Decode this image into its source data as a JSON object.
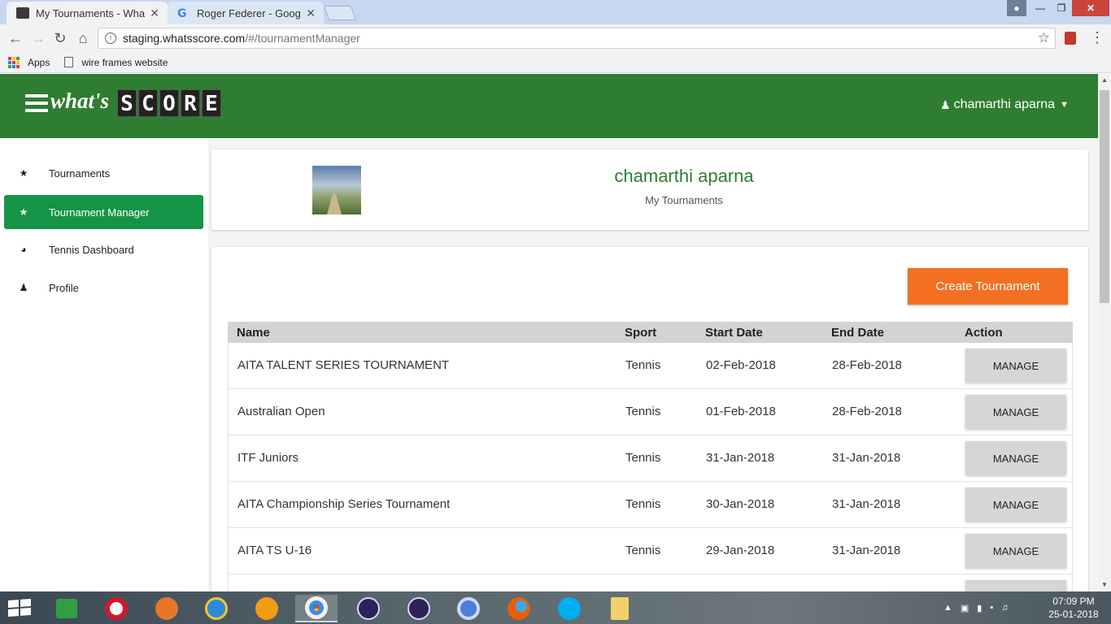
{
  "browser": {
    "tabs": [
      {
        "title": "My Tournaments - What",
        "close": "✕"
      },
      {
        "title": "Roger Federer - Google S",
        "close": "✕"
      }
    ],
    "url_host": "staging.whatsscore.com",
    "url_path": "/#/tournamentManager",
    "bookmarks": [
      {
        "label": "Apps"
      },
      {
        "label": "wire frames website"
      }
    ]
  },
  "header": {
    "logo_prefix": "what's",
    "logo_letters": [
      "S",
      "C",
      "O",
      "R",
      "E"
    ],
    "user_name": "chamarthi aparna"
  },
  "sidebar": {
    "items": [
      {
        "label": "Tournaments",
        "icon": "trophy-icon"
      },
      {
        "label": "Tournament Manager",
        "icon": "trophy-icon"
      },
      {
        "label": "Tennis Dashboard",
        "icon": "dashboard-icon"
      },
      {
        "label": "Profile",
        "icon": "user-icon"
      }
    ]
  },
  "profile": {
    "name": "chamarthi aparna",
    "subtitle": "My Tournaments"
  },
  "create_button_label": "Create Tournament",
  "table": {
    "headers": {
      "name": "Name",
      "sport": "Sport",
      "start": "Start Date",
      "end": "End Date",
      "action": "Action"
    },
    "rows": [
      {
        "name": "AITA TALENT SERIES TOURNAMENT",
        "sport": "Tennis",
        "start": "02-Feb-2018",
        "end": "28-Feb-2018",
        "action": "MANAGE"
      },
      {
        "name": "Australian Open",
        "sport": "Tennis",
        "start": "01-Feb-2018",
        "end": "28-Feb-2018",
        "action": "MANAGE"
      },
      {
        "name": "ITF Juniors",
        "sport": "Tennis",
        "start": "31-Jan-2018",
        "end": "31-Jan-2018",
        "action": "MANAGE"
      },
      {
        "name": "AITA Championship Series Tournament",
        "sport": "Tennis",
        "start": "30-Jan-2018",
        "end": "31-Jan-2018",
        "action": "MANAGE"
      },
      {
        "name": "AITA TS U-16",
        "sport": "Tennis",
        "start": "29-Jan-2018",
        "end": "31-Jan-2018",
        "action": "MANAGE"
      }
    ]
  },
  "taskbar": {
    "time": "07:09 PM",
    "date": "25-01-2018"
  },
  "colors": {
    "header_green": "#2e7d32",
    "sidebar_active": "#159447",
    "create_orange": "#f36f21"
  }
}
